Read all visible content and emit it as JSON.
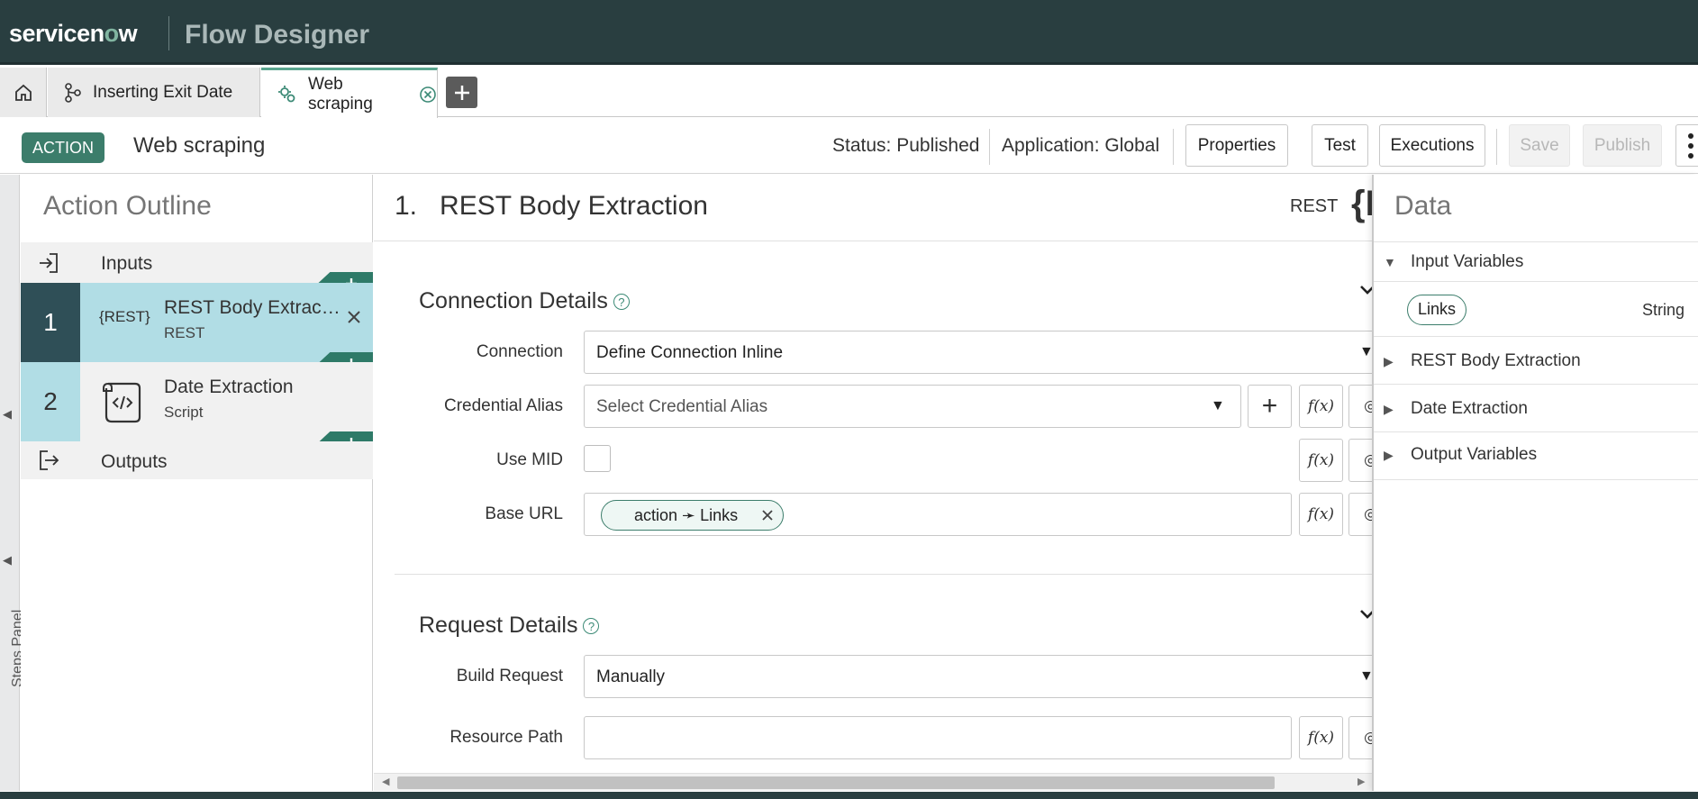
{
  "header": {
    "brand": "servicenow",
    "product": "Flow Designer"
  },
  "tabs": [
    {
      "label": "Inserting Exit Date"
    },
    {
      "label": "Web scraping"
    }
  ],
  "action_bar": {
    "badge": "ACTION",
    "title": "Web scraping",
    "status": "Status: Published",
    "application": "Application: Global",
    "buttons": {
      "properties": "Properties",
      "test": "Test",
      "executions": "Executions",
      "save": "Save",
      "publish": "Publish"
    }
  },
  "steps_panel": {
    "label": "Steps Panel"
  },
  "outline": {
    "title": "Action Outline",
    "inputs_label": "Inputs",
    "outputs_label": "Outputs",
    "steps": [
      {
        "number": "1",
        "icon_text": "{REST}",
        "name": "REST Body Extract…",
        "type": "REST"
      },
      {
        "number": "2",
        "name": "Date Extraction",
        "type": "Script"
      }
    ]
  },
  "main": {
    "title_number": "1.",
    "title": "REST Body Extraction",
    "step_type": "REST",
    "connection_details": {
      "title": "Connection Details",
      "connection_label": "Connection",
      "connection_value": "Define Connection Inline",
      "credential_alias_label": "Credential Alias",
      "credential_alias_placeholder": "Select Credential Alias",
      "use_mid_label": "Use MID",
      "base_url_label": "Base URL",
      "base_url_pill": "action ➛ Links"
    },
    "request_details": {
      "title": "Request Details",
      "build_request_label": "Build Request",
      "build_request_value": "Manually",
      "resource_path_label": "Resource Path",
      "resource_path_value": ""
    },
    "function_button": "f(x)"
  },
  "data_panel": {
    "title": "Data",
    "sections": [
      {
        "label": "Input Variables",
        "expanded": true
      },
      {
        "label": "REST Body Extraction",
        "expanded": false
      },
      {
        "label": "Date Extraction",
        "expanded": false
      },
      {
        "label": "Output Variables",
        "expanded": false
      }
    ],
    "variable": {
      "name": "Links",
      "type": "String"
    }
  },
  "colors": {
    "header_bg": "#293e40",
    "accent": "#3c7d6b",
    "selected_step": "#b1dde5"
  }
}
